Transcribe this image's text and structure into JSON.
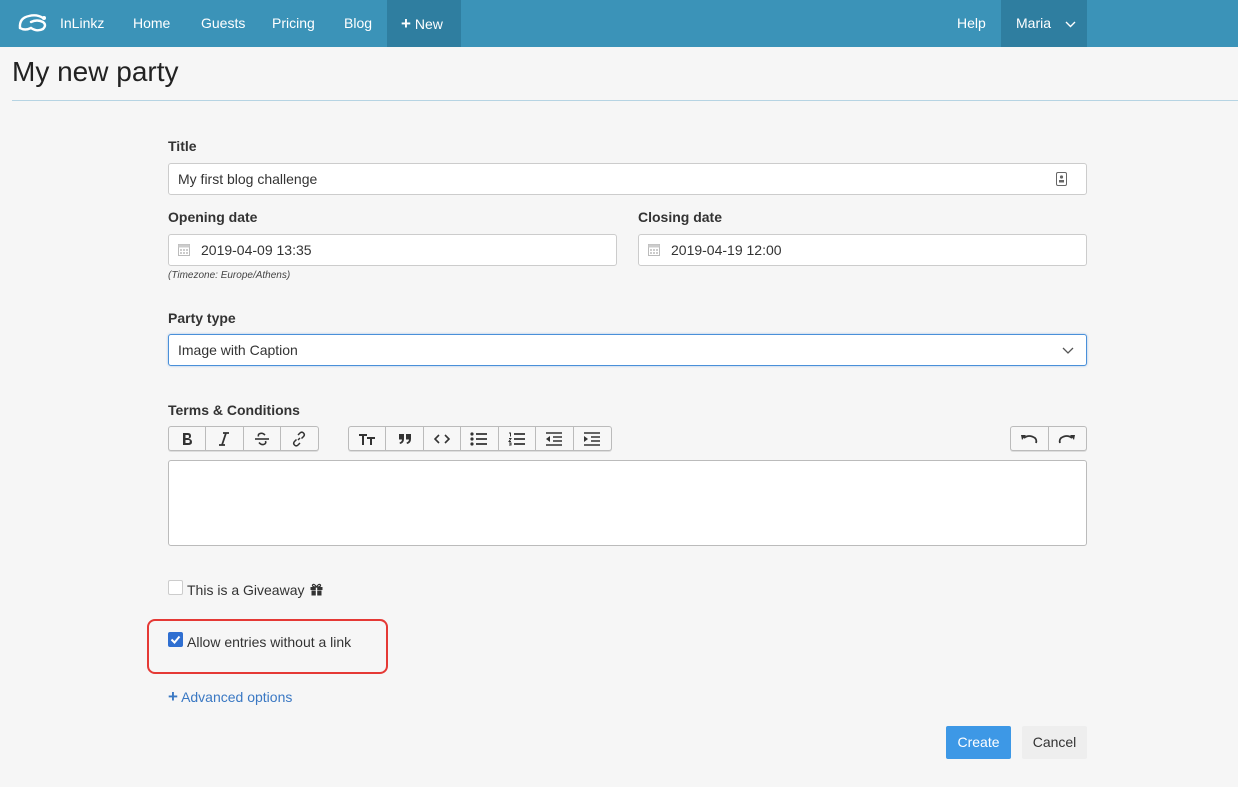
{
  "nav": {
    "brand": "InLinkz",
    "home": "Home",
    "guests": "Guests",
    "pricing": "Pricing",
    "blog": "Blog",
    "new": "New",
    "help": "Help",
    "user": "Maria"
  },
  "page": {
    "title": "My new party"
  },
  "form": {
    "title_label": "Title",
    "title_value": "My first blog challenge",
    "opening_label": "Opening date",
    "opening_value": "2019-04-09 13:35",
    "closing_label": "Closing date",
    "closing_value": "2019-04-19 12:00",
    "timezone_note": "(Timezone: Europe/Athens)",
    "party_type_label": "Party type",
    "party_type_value": "Image with Caption",
    "terms_label": "Terms & Conditions",
    "giveaway_label": "This is a Giveaway",
    "giveaway_checked": false,
    "allow_no_link_label": "Allow entries without a link",
    "allow_no_link_checked": true,
    "advanced_label": "Advanced options",
    "create_label": "Create",
    "cancel_label": "Cancel"
  },
  "colors": {
    "navbar": "#3b93b8",
    "navbar_active": "#2f7ea0",
    "primary_button": "#3d98e6",
    "highlight": "#e53935",
    "link": "#3a78c3"
  }
}
